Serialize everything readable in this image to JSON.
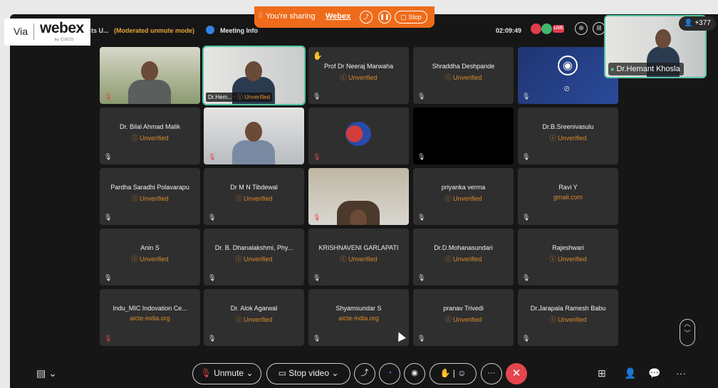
{
  "branding": {
    "via": "Via",
    "logo": "webex",
    "sub": "by CISCO"
  },
  "share_banner": {
    "text": "You're sharing",
    "app": "Webex",
    "stop_label": "Stop",
    "grip_icon": "grip-icon",
    "share_icon": "share-icon",
    "pause_icon": "pause-icon",
    "stop_icon": "stop-square-icon"
  },
  "topbar": {
    "meeting_title_fragment": "ts U...",
    "moderated": "(Moderated unmute mode)",
    "meeting_info": "Meeting Info",
    "elapsed": "02:09:49",
    "live_label": "LIVE",
    "zoom_icon": "zoom-icon",
    "layout_icon": "layout-icon"
  },
  "self_view": {
    "name": "Dr.Hemant Khosla"
  },
  "participant_count": "+377",
  "tiles": [
    {
      "name": "",
      "status": "",
      "kind": "video"
    },
    {
      "name": "Dr.Hem...",
      "status": "Unverified",
      "kind": "video-active"
    },
    {
      "name": "Prof Dr Neeraj Marwaha",
      "status": "Unverified",
      "hand": "✋"
    },
    {
      "name": "Shraddha Deshpande",
      "status": "Unverified"
    },
    {
      "name": "",
      "status": "",
      "kind": "obs"
    },
    {
      "name": "Dr. Bilal Ahmad Malik",
      "status": "Unverified"
    },
    {
      "name": "",
      "status": "",
      "kind": "video"
    },
    {
      "name": "",
      "status": "",
      "kind": "brain"
    },
    {
      "name": "",
      "status": "",
      "kind": "black"
    },
    {
      "name": "Dr.B.Sreenivasulu",
      "status": "Unverified"
    },
    {
      "name": "Pardha Saradhi Polavarapu",
      "status": "Unverified"
    },
    {
      "name": "Dr M N Tibdewal",
      "status": "Unverified"
    },
    {
      "name": "",
      "status": "",
      "kind": "video"
    },
    {
      "name": "priyanka verma",
      "status": "Unverified"
    },
    {
      "name": "Ravi Y",
      "status": "gmail.com"
    },
    {
      "name": "Anin S",
      "status": "Unverified"
    },
    {
      "name": "Dr. B. Dhanalakshmi, Phy...",
      "status": "Unverified"
    },
    {
      "name": "KRISHNAVENI GARLAPATI",
      "status": "Unverified"
    },
    {
      "name": "Dr.D.Mohanasundari",
      "status": "Unverified"
    },
    {
      "name": "Rajeshwari",
      "status": "Unverified"
    },
    {
      "name": "Indu_MIC Indovation Ce...",
      "status": "aicte-india.org"
    },
    {
      "name": "Dr. Alok Agarwal",
      "status": "Unverified"
    },
    {
      "name": "Shyamsundar S",
      "status": "aicte-india.org"
    },
    {
      "name": "pranav Trivedi",
      "status": "Unverified"
    },
    {
      "name": "Dr.Jarapala Ramesh Babu",
      "status": "Unverified"
    }
  ],
  "controls": {
    "unmute": "Unmute",
    "stop_video": "Stop video",
    "chat_icon": "chat-icon",
    "share_icon": "share-screen-icon",
    "ai_icon": "ai-assistant-icon",
    "record_icon": "record-icon",
    "raise_hand_icon": "raise-hand-icon",
    "reactions_icon": "reactions-icon",
    "more_icon": "more-icon",
    "leave_icon": "leave-icon",
    "apps_icon": "apps-icon",
    "participants_icon": "participants-icon",
    "chat_panel_icon": "chat-panel-icon",
    "overflow_icon": "overflow-icon"
  },
  "colors": {
    "accent": "#ef6b1a",
    "active_border": "#4cc4a4",
    "unverified": "#d98a2a",
    "leave": "#e5464d"
  }
}
